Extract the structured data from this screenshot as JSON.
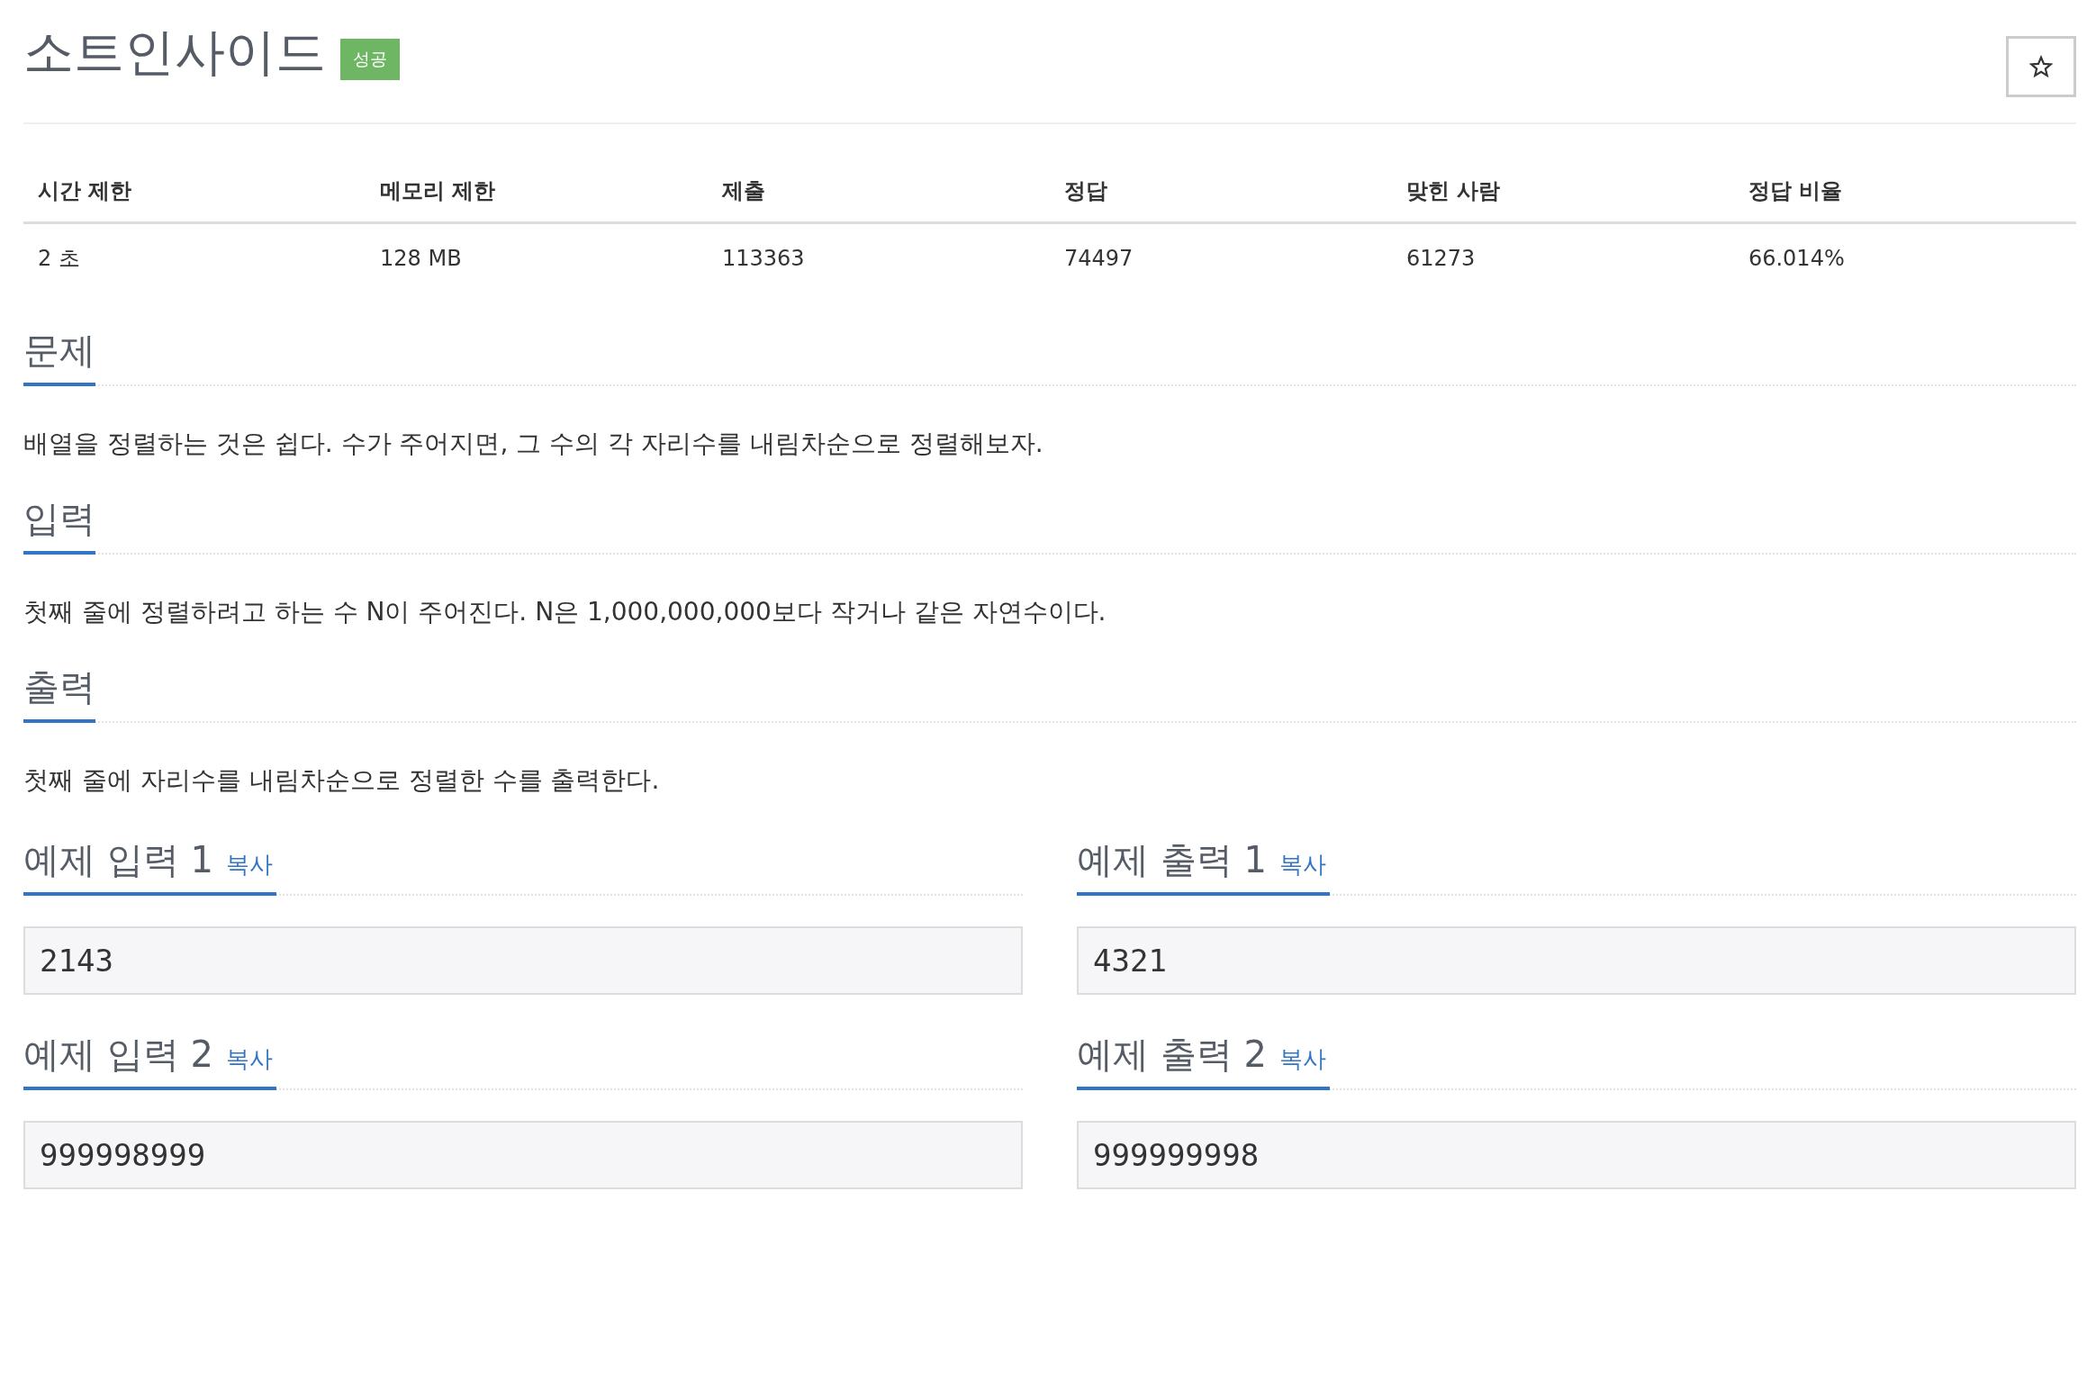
{
  "problem": {
    "title": "소트인사이드",
    "badge": "성공"
  },
  "info_table": {
    "columns": [
      "시간 제한",
      "메모리 제한",
      "제출",
      "정답",
      "맞힌 사람",
      "정답 비율"
    ],
    "rows": [
      [
        "2 초",
        "128 MB",
        "113363",
        "74497",
        "61273",
        "66.014%"
      ]
    ]
  },
  "sections": [
    {
      "heading": "문제",
      "text": "배열을 정렬하는 것은 쉽다. 수가 주어지면, 그 수의 각 자리수를 내림차순으로 정렬해보자."
    },
    {
      "heading": "입력",
      "text": "첫째 줄에 정렬하려고 하는 수 N이 주어진다. N은 1,000,000,000보다 작거나 같은 자연수이다."
    },
    {
      "heading": "출력",
      "text": "첫째 줄에 자리수를 내림차순으로 정렬한 수를 출력한다."
    }
  ],
  "samples": [
    {
      "heading": "예제 입력 1",
      "copy": "복사",
      "value": "2143"
    },
    {
      "heading": "예제 출력 1",
      "copy": "복사",
      "value": "4321"
    },
    {
      "heading": "예제 입력 2",
      "copy": "복사",
      "value": "999998999"
    },
    {
      "heading": "예제 출력 2",
      "copy": "복사",
      "value": "999999998"
    }
  ]
}
